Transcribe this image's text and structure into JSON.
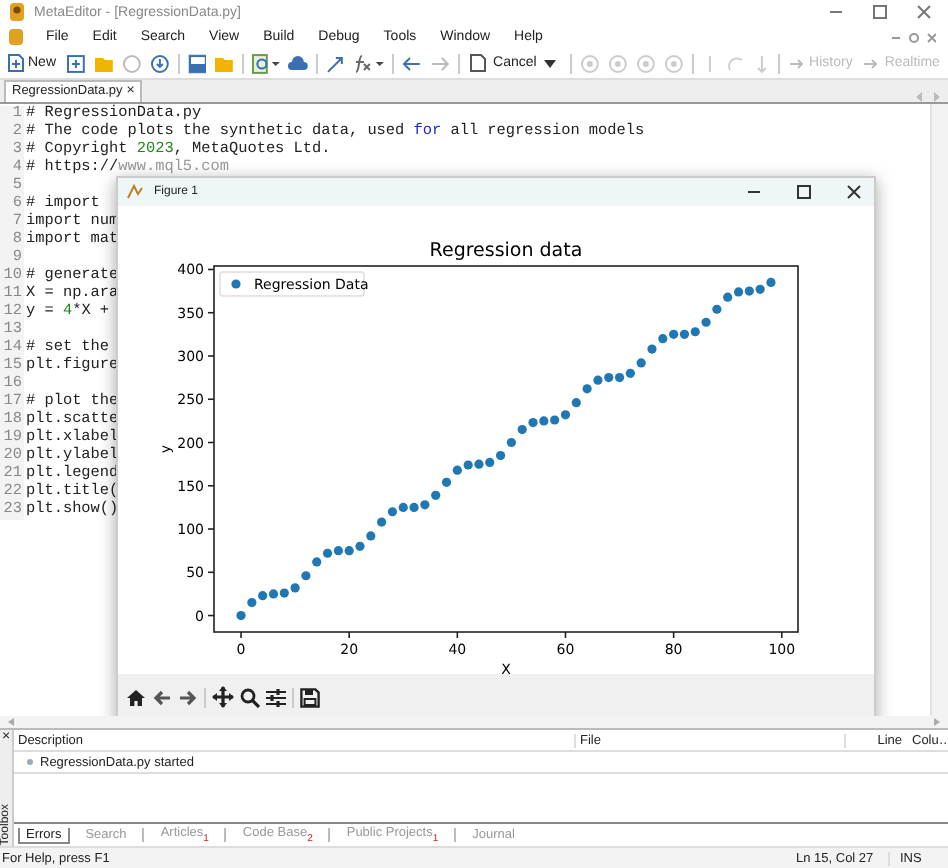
{
  "window": {
    "title": "MetaEditor - [RegressionData.py]"
  },
  "menu": [
    "File",
    "Edit",
    "Search",
    "View",
    "Build",
    "Debug",
    "Tools",
    "Window",
    "Help"
  ],
  "toolbar": {
    "new": "New",
    "cancel": "Cancel",
    "history": {
      "label": "History",
      "disabled": true
    },
    "realtime": {
      "label": "Realtime",
      "disabled": true
    }
  },
  "editor_tabs": [
    {
      "label": "RegressionData.py",
      "close": "×",
      "selected": true
    }
  ],
  "code_lines": [
    {
      "number": "1",
      "segments": [
        {
          "text": "# RegressionData.py",
          "kind": "plain"
        }
      ]
    },
    {
      "number": "2",
      "segments": [
        {
          "text": "# The code plots the synthetic data, used ",
          "kind": "plain"
        },
        {
          "text": "for",
          "kind": "keyword"
        },
        {
          "text": " all regression models",
          "kind": "plain"
        }
      ]
    },
    {
      "number": "3",
      "segments": [
        {
          "text": "# Copyright ",
          "kind": "plain"
        },
        {
          "text": "2023",
          "kind": "number"
        },
        {
          "text": ", MetaQuotes Ltd.",
          "kind": "plain"
        }
      ]
    },
    {
      "number": "4",
      "segments": [
        {
          "text": "# https://",
          "kind": "plain"
        },
        {
          "text": "www.mql5.com",
          "kind": "link"
        }
      ]
    },
    {
      "number": "5"
    },
    {
      "number": "6",
      "segments": [
        {
          "text": "# import",
          "kind": "plain"
        }
      ]
    },
    {
      "number": "7",
      "segments": [
        {
          "text": "import num",
          "kind": "plain"
        }
      ]
    },
    {
      "number": "8",
      "segments": [
        {
          "text": "import mat",
          "kind": "plain"
        }
      ]
    },
    {
      "number": "9"
    },
    {
      "number": "10",
      "segments": [
        {
          "text": "# generate",
          "kind": "plain"
        }
      ]
    },
    {
      "number": "11",
      "segments": [
        {
          "text": "X = np.ara",
          "kind": "plain"
        }
      ]
    },
    {
      "number": "12",
      "segments": [
        {
          "text": "y = ",
          "kind": "plain"
        },
        {
          "text": "4",
          "kind": "number"
        },
        {
          "text": "*X + ",
          "kind": "plain"
        }
      ]
    },
    {
      "number": "13"
    },
    {
      "number": "14",
      "segments": [
        {
          "text": "# set the",
          "kind": "plain"
        }
      ]
    },
    {
      "number": "15",
      "segments": [
        {
          "text": "plt.figure",
          "kind": "plain"
        }
      ]
    },
    {
      "number": "16"
    },
    {
      "number": "17",
      "segments": [
        {
          "text": "# plot the",
          "kind": "plain"
        }
      ]
    },
    {
      "number": "18",
      "segments": [
        {
          "text": "plt.scatte",
          "kind": "plain"
        }
      ]
    },
    {
      "number": "19",
      "segments": [
        {
          "text": "plt.xlabel",
          "kind": "plain"
        }
      ]
    },
    {
      "number": "20",
      "segments": [
        {
          "text": "plt.ylabel",
          "kind": "plain"
        }
      ]
    },
    {
      "number": "21",
      "segments": [
        {
          "text": "plt.legend",
          "kind": "plain"
        }
      ]
    },
    {
      "number": "22",
      "segments": [
        {
          "text": "plt.title(",
          "kind": "plain"
        }
      ]
    },
    {
      "number": "23",
      "segments": [
        {
          "text": "plt.show()",
          "kind": "plain"
        }
      ]
    }
  ],
  "figure": {
    "title": "Figure 1",
    "chart_data": {
      "type": "scatter",
      "title": "Regression data",
      "xlabel": "X",
      "ylabel": "y",
      "x": [
        0,
        2,
        4,
        6,
        8,
        10,
        12,
        14,
        16,
        18,
        20,
        22,
        24,
        26,
        28,
        30,
        32,
        34,
        36,
        38,
        40,
        42,
        44,
        46,
        48,
        50,
        52,
        54,
        56,
        58,
        60,
        62,
        64,
        66,
        68,
        70,
        72,
        74,
        76,
        78,
        80,
        82,
        84,
        86,
        88,
        90,
        92,
        94,
        96,
        98
      ],
      "series": [
        {
          "name": "Regression Data",
          "color": "#1f77b4",
          "values": [
            0,
            15,
            23,
            25,
            26,
            32,
            46,
            62,
            72,
            75,
            75,
            80,
            92,
            108,
            120,
            125,
            125,
            128,
            139,
            154,
            168,
            174,
            175,
            177,
            185,
            200,
            215,
            223,
            225,
            226,
            232,
            246,
            262,
            272,
            275,
            275,
            280,
            292,
            308,
            320,
            325,
            325,
            328,
            339,
            354,
            368,
            374,
            375,
            377,
            385
          ]
        }
      ],
      "xlim": [
        -5,
        103
      ],
      "ylim": [
        -19,
        404
      ],
      "xticks": [
        0,
        20,
        40,
        60,
        80,
        100
      ],
      "yticks": [
        0,
        50,
        100,
        150,
        200,
        250,
        300,
        350,
        400
      ]
    }
  },
  "messages": {
    "columns": [
      "Description",
      "File",
      "Line",
      "Colu…"
    ],
    "rows": [
      {
        "description": "RegressionData.py started"
      }
    ]
  },
  "toolbox": {
    "label": "Toolbox",
    "close": "×"
  },
  "bottom_tabs": [
    {
      "label": "Errors",
      "selected": true
    },
    {
      "label": "Search",
      "selected": false
    },
    {
      "label": "Articles$_{1}$",
      "selected": false
    },
    {
      "label": "Code Base$_{2}$",
      "selected": false
    },
    {
      "label": "Public Projects$_{1}$",
      "selected": false
    },
    {
      "label": "Journal",
      "selected": false
    }
  ],
  "status_bar": {
    "help": "For Help, press F1",
    "position": "Ln 15, Col 27",
    "mode": "INS"
  }
}
